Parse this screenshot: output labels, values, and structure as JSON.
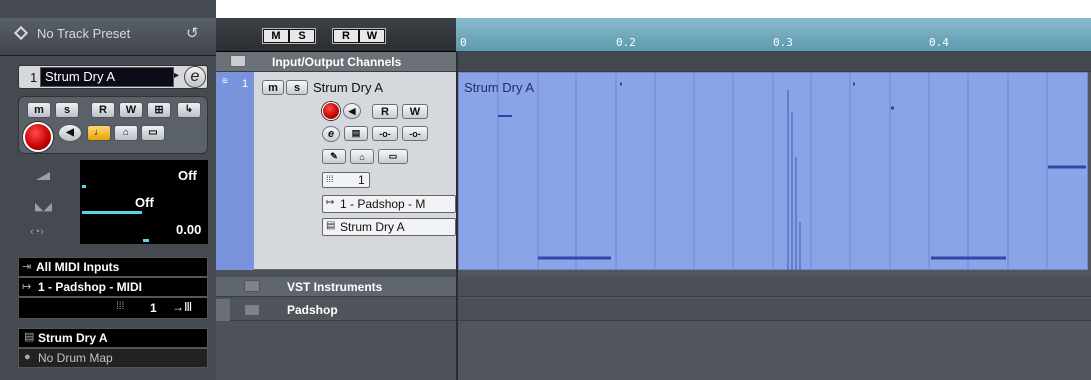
{
  "inspector": {
    "track_preset": "No Track Preset",
    "track_number": "1",
    "track_name": "Strum Dry A",
    "buttons": {
      "mute": "m",
      "solo": "s",
      "read": "R",
      "write": "W"
    },
    "volume_value": "Off",
    "pan_value": "Off",
    "delay_value": "0.00",
    "input_routing": "All MIDI Inputs",
    "output_routing": "1 - Padshop - MIDI",
    "channel_value": "1",
    "program_name": "Strum Dry A",
    "drum_map": "No Drum Map"
  },
  "toolbar": {
    "mute_solo_labels": [
      "M",
      "S"
    ],
    "read_write_labels": [
      "R",
      "W"
    ]
  },
  "tracklist": {
    "folder_io": "Input/Output Channels",
    "track": {
      "number": "1",
      "mute": "m",
      "solo": "s",
      "name": "Strum Dry A",
      "read": "R",
      "write": "W",
      "channel": "1",
      "output": "1 - Padshop - M",
      "program": "Strum Dry A"
    },
    "folder_vsti": "VST Instruments",
    "folder_padshop": "Padshop"
  },
  "ruler": {
    "ticks": [
      "0",
      "0.2",
      "0.3",
      "0.4"
    ]
  },
  "event": {
    "name": "Strum Dry A",
    "color": "#8aa3e8"
  },
  "colors": {
    "panel": "#4b5158",
    "track_selected": "#7f95de",
    "ruler": "#7fb3c5"
  }
}
